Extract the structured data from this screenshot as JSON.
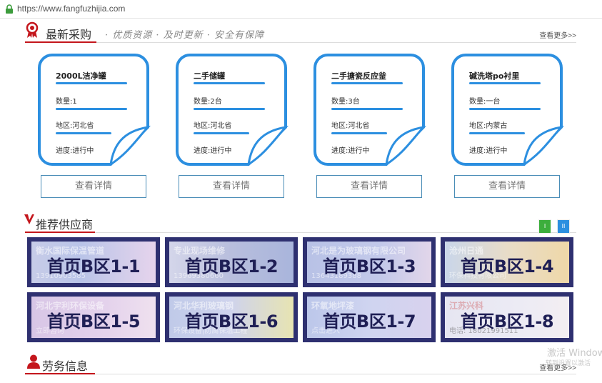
{
  "browser": {
    "url": "https://www.fangfuzhijia.com"
  },
  "latest_purchase": {
    "title": "最新采购",
    "slogan": "· 优质资源 · 及时更新 · 安全有保障",
    "more": "查看更多>>",
    "cards": [
      {
        "name": "2000L洁净罐",
        "qty": "数量:1",
        "region": "地区:河北省",
        "progress": "进度:进行中",
        "button": "查看详情"
      },
      {
        "name": "二手储罐",
        "qty": "数量:2台",
        "region": "地区:河北省",
        "progress": "进度:进行中",
        "button": "查看详情"
      },
      {
        "name": "二手搪瓷反应釜",
        "qty": "数量:3台",
        "region": "地区:河北省",
        "progress": "进度:进行中",
        "button": "查看详情"
      },
      {
        "name": "碱洗塔po衬里",
        "qty": "数量:一台",
        "region": "地区:内蒙古",
        "progress": "进度:进行中",
        "button": "查看详情"
      }
    ]
  },
  "suppliers": {
    "title": "推荐供应商",
    "pager": [
      "I",
      "II"
    ],
    "colors": {
      "pager_green": "#3cae3c",
      "pager_blue": "#2c8fe0",
      "ad_border": "#2e3070",
      "accent_red": "#c4161c",
      "card_blue": "#2c8fe0"
    },
    "ads": [
      {
        "label": "首页B区1-1",
        "faint_top": "衡水国际保温管道",
        "faint_bottom": "13910903585"
      },
      {
        "label": "首页B区1-2",
        "faint_top": "专业现场维修",
        "faint_bottom": "13969380660"
      },
      {
        "label": "首页B区1-3",
        "faint_top": "河北是为玻璃钢有限公司",
        "faint_bottom": "13643189388"
      },
      {
        "label": "首页B区1-4",
        "faint_top": "沧州日通",
        "faint_bottom": "环保科技有限公司"
      },
      {
        "label": "首页B区1-5",
        "faint_top": "河北宇利环保设备",
        "faint_bottom": "立即咨询"
      },
      {
        "label": "首页B区1-6",
        "faint_top": "河北华利玻璃钢",
        "faint_bottom": "环保设备|防腐保温工程"
      },
      {
        "label": "首页B区1-7",
        "faint_top": "环氧地坪漆",
        "faint_bottom": "点击进入"
      },
      {
        "label": "首页B区1-8",
        "faint_top": "江苏兴科",
        "faint_bottom": "电话: 18021991511"
      }
    ]
  },
  "labor": {
    "title": "劳务信息",
    "more": "查看更多>>"
  },
  "watermark": {
    "line1": "激活 Window",
    "line2": "转到设置以激活"
  }
}
